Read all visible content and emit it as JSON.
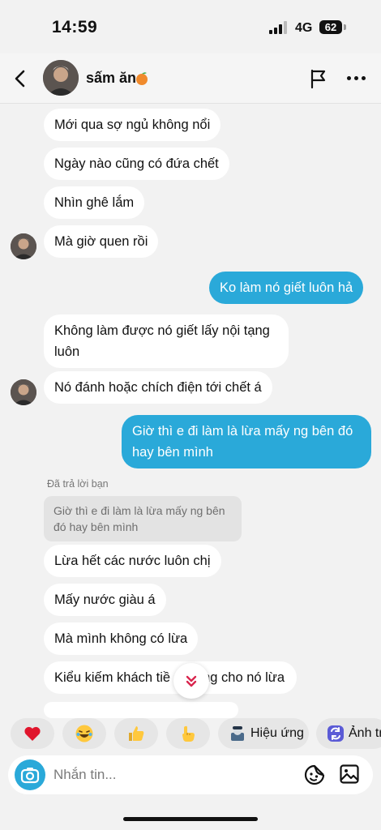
{
  "status_bar": {
    "time": "14:59",
    "network": "4G",
    "battery": "62"
  },
  "header": {
    "contact_name": "sấm ăn",
    "contact_emoji": "peach-emoji",
    "icons": [
      "back-chevron-icon",
      "flag-icon",
      "more-icon"
    ]
  },
  "messages": [
    {
      "from": "them",
      "text": "Mới qua sợ ngủ không nổi"
    },
    {
      "from": "them",
      "text": "Ngày nào cũng có đứa chết"
    },
    {
      "from": "them",
      "text": "Nhìn ghê lắm"
    },
    {
      "from": "them",
      "text": "Mà giờ quen rồi"
    },
    {
      "from": "me",
      "text": "Ko làm nó giết luôn hả"
    },
    {
      "from": "them",
      "text": "Không làm được nó giết lấy nội tạng luôn"
    },
    {
      "from": "them",
      "text": "Nó đánh hoặc chích điện tới chết á"
    },
    {
      "from": "me",
      "text": "Giờ thì e đi làm là lừa mấy ng bên đó hay bên mình"
    },
    {
      "from": "them",
      "reply_label": "Đã trả lời bạn",
      "quoted": "Giờ thì e đi làm là lừa mấy ng bên đó hay bên mình",
      "text": "Lừa hết các nước luôn chị"
    },
    {
      "from": "them",
      "text": "Mấy nước giàu á"
    },
    {
      "from": "them",
      "text": "Mà mình không có lừa"
    },
    {
      "from": "them",
      "text_left": "Kiểu kiếm khách tiề",
      "text_right": "ng cho nó lừa"
    }
  ],
  "quick_actions": [
    {
      "icon": "heart-emoji"
    },
    {
      "icon": "laughing-emoji"
    },
    {
      "icon": "thumbs-up-emoji"
    },
    {
      "icon": "pointing-emoji"
    },
    {
      "icon": "effects-icon",
      "label": "Hiệu ứng"
    },
    {
      "icon": "ai-image-icon",
      "label": "Ảnh tr"
    }
  ],
  "composer": {
    "placeholder": "Nhắn tin...",
    "icons": [
      "camera-icon",
      "sticker-icon",
      "gallery-icon"
    ]
  },
  "colors": {
    "outgoing_bubble": "#2aa9d9",
    "incoming_bubble": "#ffffff",
    "background": "#f2f2f2"
  }
}
